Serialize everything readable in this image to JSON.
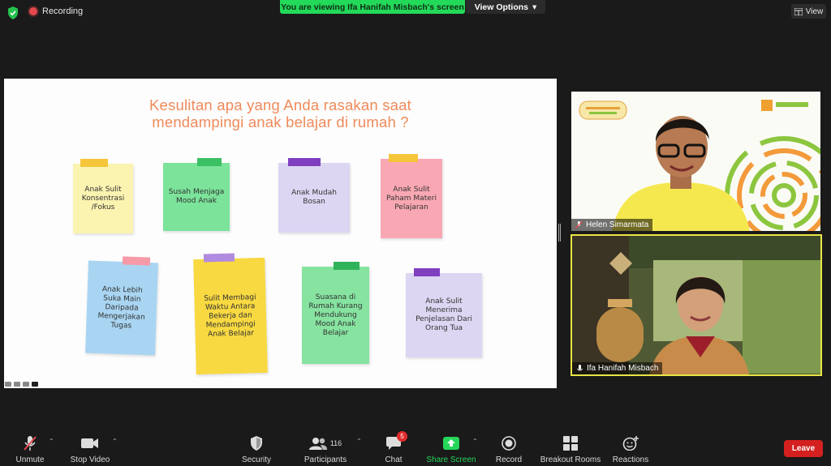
{
  "topbar": {
    "recording_label": "Recording",
    "viewing_banner": "You are viewing Ifa Hanifah Misbach's screen",
    "view_options_label": "View Options",
    "view_label": "View"
  },
  "slide": {
    "title_line1": "Kesulitan apa yang Anda rasakan saat",
    "title_line2": "mendampingi anak belajar di rumah ?",
    "notes": [
      {
        "text": "Anak Sulit Konsentrasi /Fokus",
        "color": "#fbf3b0",
        "tape": "#f5c53a"
      },
      {
        "text": "Susah Menjaga Mood Anak",
        "color": "#7be39a",
        "tape": "#3cc064"
      },
      {
        "text": "Anak Mudah Bosan",
        "color": "#dcd6f2",
        "tape": "#7f3fbf"
      },
      {
        "text": "Anak Sulit Paham Materi Pelajaran",
        "color": "#f9a8b3",
        "tape": "#f5c53a"
      },
      {
        "text": "Anak Lebih Suka Main Daripada Mengerjakan Tugas",
        "color": "#a9d5f2",
        "tape": "#f79aa8"
      },
      {
        "text": "Sulit Membagi Waktu Antara Bekerja dan Mendampingi Anak Belajar",
        "color": "#f8d941",
        "tape": "#b18be0"
      },
      {
        "text": "Suasana di Rumah Kurang Mendukung Mood Anak Belajar",
        "color": "#86e3a0",
        "tape": "#2fb35a"
      },
      {
        "text": "Anak Sulit Menerima Penjelasan Dari Orang Tua",
        "color": "#dcd6f2",
        "tape": "#7f3fbf"
      }
    ]
  },
  "participants_video": [
    {
      "name": "Helen Simarmata"
    },
    {
      "name": "Ifa Hanifah Misbach"
    }
  ],
  "toolbar": {
    "unmute": "Unmute",
    "stop_video": "Stop Video",
    "security": "Security",
    "participants": "Participants",
    "participants_count": "116",
    "chat": "Chat",
    "chat_badge": "5",
    "share_screen": "Share Screen",
    "record": "Record",
    "breakout_rooms": "Breakout Rooms",
    "reactions": "Reactions",
    "leave": "Leave"
  },
  "colors": {
    "banner_green": "#23d959",
    "leave_red": "#d4201f",
    "active_speaker_border": "#e8e545",
    "slide_title": "#ef8a5a"
  }
}
